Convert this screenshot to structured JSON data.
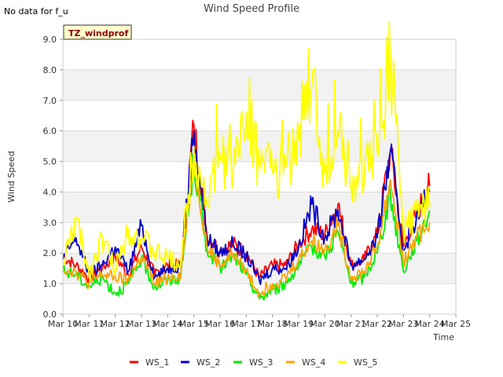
{
  "notice": "No data for f_u",
  "chart_data": {
    "type": "line",
    "title": "Wind Speed Profile",
    "xlabel": "Time",
    "ylabel": "Wind Speed",
    "site_label": "TZ_windprof",
    "ylim": [
      0,
      9
    ],
    "yticks": [
      "0.0",
      "1.0",
      "2.0",
      "3.0",
      "4.0",
      "5.0",
      "6.0",
      "7.0",
      "8.0",
      "9.0"
    ],
    "xlim_days": [
      10,
      25
    ],
    "xticks": [
      "Mar 10",
      "Mar 11",
      "Mar 12",
      "Mar 13",
      "Mar 14",
      "Mar 15",
      "Mar 16",
      "Mar 17",
      "Mar 18",
      "Mar 19",
      "Mar 20",
      "Mar 21",
      "Mar 22",
      "Mar 23",
      "Mar 24",
      "Mar 25"
    ],
    "grid": true,
    "legend_position": "bottom",
    "series_colors": [
      "#ff0000",
      "#0000cc",
      "#00ee00",
      "#ffa500",
      "#ffff00"
    ],
    "series": [
      {
        "name": "WS_1",
        "x": [
          "Mar 10",
          "Mar 10.5",
          "Mar 11",
          "Mar 11.5",
          "Mar 12",
          "Mar 12.5",
          "Mar 13",
          "Mar 13.5",
          "Mar 14",
          "Mar 14.5",
          "Mar 15",
          "Mar 15.5",
          "Mar 16",
          "Mar 16.5",
          "Mar 17",
          "Mar 17.5",
          "Mar 18",
          "Mar 18.5",
          "Mar 19",
          "Mar 19.5",
          "Mar 20",
          "Mar 20.5",
          "Mar 21",
          "Mar 21.5",
          "Mar 22",
          "Mar 22.5",
          "Mar 23",
          "Mar 23.5",
          "Mar 24"
        ],
        "values": [
          1.9,
          1.6,
          1.2,
          1.5,
          1.9,
          1.3,
          2.2,
          1.3,
          1.6,
          1.6,
          6.2,
          2.6,
          2.1,
          2.3,
          2.0,
          1.2,
          1.6,
          1.6,
          2.3,
          2.8,
          2.6,
          3.6,
          1.6,
          1.8,
          2.6,
          5.4,
          2.2,
          3.3,
          4.2
        ]
      },
      {
        "name": "WS_2",
        "x": [
          "Mar 10",
          "Mar 10.5",
          "Mar 11",
          "Mar 11.5",
          "Mar 12",
          "Mar 12.5",
          "Mar 13",
          "Mar 13.5",
          "Mar 14",
          "Mar 14.5",
          "Mar 15",
          "Mar 15.5",
          "Mar 16",
          "Mar 16.5",
          "Mar 17",
          "Mar 17.5",
          "Mar 18",
          "Mar 18.5",
          "Mar 19",
          "Mar 19.5",
          "Mar 20",
          "Mar 20.5",
          "Mar 21",
          "Mar 21.5",
          "Mar 22",
          "Mar 22.5",
          "Mar 23",
          "Mar 23.5",
          "Mar 24"
        ],
        "values": [
          1.8,
          2.5,
          1.3,
          1.6,
          2.2,
          1.4,
          2.9,
          1.2,
          1.5,
          1.6,
          6.0,
          2.5,
          2.0,
          2.3,
          1.9,
          1.1,
          1.5,
          1.5,
          2.2,
          3.6,
          2.5,
          3.4,
          1.6,
          1.8,
          2.5,
          5.3,
          2.1,
          3.2,
          4.0
        ]
      },
      {
        "name": "WS_3",
        "x": [
          "Mar 10",
          "Mar 10.5",
          "Mar 11",
          "Mar 11.5",
          "Mar 12",
          "Mar 12.5",
          "Mar 13",
          "Mar 13.5",
          "Mar 14",
          "Mar 14.5",
          "Mar 15",
          "Mar 15.5",
          "Mar 16",
          "Mar 16.5",
          "Mar 17",
          "Mar 17.5",
          "Mar 18",
          "Mar 18.5",
          "Mar 19",
          "Mar 19.5",
          "Mar 20",
          "Mar 20.5",
          "Mar 21",
          "Mar 21.5",
          "Mar 22",
          "Mar 22.5",
          "Mar 23",
          "Mar 23.5",
          "Mar 24"
        ],
        "values": [
          1.4,
          1.3,
          0.9,
          1.2,
          0.7,
          1.0,
          1.8,
          0.9,
          1.1,
          1.2,
          5.0,
          2.1,
          1.5,
          1.9,
          1.3,
          0.5,
          0.8,
          1.0,
          1.6,
          2.2,
          1.9,
          2.7,
          1.0,
          1.2,
          2.0,
          3.9,
          1.4,
          2.4,
          3.4
        ]
      },
      {
        "name": "WS_4",
        "x": [
          "Mar 10",
          "Mar 10.5",
          "Mar 11",
          "Mar 11.5",
          "Mar 12",
          "Mar 12.5",
          "Mar 13",
          "Mar 13.5",
          "Mar 14",
          "Mar 14.5",
          "Mar 15",
          "Mar 15.5",
          "Mar 16",
          "Mar 16.5",
          "Mar 17",
          "Mar 17.5",
          "Mar 18",
          "Mar 18.5",
          "Mar 19",
          "Mar 19.5",
          "Mar 20",
          "Mar 20.5",
          "Mar 21",
          "Mar 21.5",
          "Mar 22",
          "Mar 22.5",
          "Mar 23",
          "Mar 23.5",
          "Mar 24"
        ],
        "values": [
          1.5,
          1.4,
          1.0,
          1.3,
          1.2,
          1.1,
          1.9,
          1.0,
          1.2,
          1.3,
          5.2,
          2.2,
          1.6,
          2.0,
          1.4,
          0.7,
          1.0,
          1.2,
          1.8,
          2.4,
          2.1,
          2.9,
          1.2,
          1.4,
          2.2,
          4.4,
          1.7,
          2.5,
          3.0
        ]
      },
      {
        "name": "WS_5",
        "x": [
          "Mar 10",
          "Mar 10.5",
          "Mar 11",
          "Mar 11.5",
          "Mar 12",
          "Mar 12.5",
          "Mar 13",
          "Mar 13.5",
          "Mar 14",
          "Mar 14.5",
          "Mar 15",
          "Mar 15.5",
          "Mar 16",
          "Mar 16.5",
          "Mar 17",
          "Mar 17.5",
          "Mar 18",
          "Mar 18.5",
          "Mar 19",
          "Mar 19.5",
          "Mar 20",
          "Mar 20.5",
          "Mar 21",
          "Mar 21.5",
          "Mar 22",
          "Mar 22.5",
          "Mar 23",
          "Mar 23.5",
          "Mar 24"
        ],
        "values": [
          1.6,
          3.1,
          1.3,
          2.5,
          1.5,
          2.8,
          2.5,
          2.0,
          1.8,
          1.7,
          5.5,
          3.6,
          5.2,
          4.6,
          6.6,
          4.9,
          4.6,
          4.8,
          5.7,
          7.4,
          4.6,
          6.0,
          4.2,
          4.3,
          5.3,
          8.4,
          2.7,
          3.4,
          3.5
        ]
      }
    ]
  }
}
